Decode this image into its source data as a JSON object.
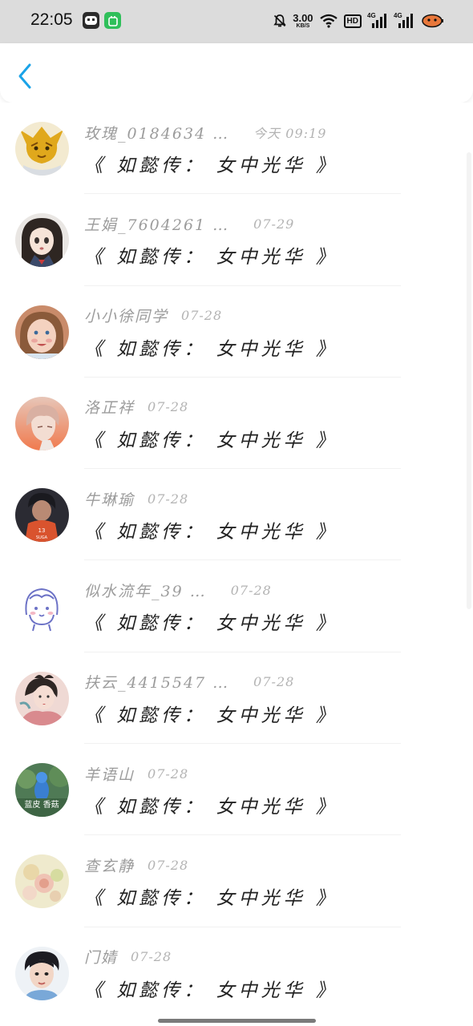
{
  "status_bar": {
    "time": "22:05",
    "apps": [
      "chat-app-icon",
      "green-app-icon"
    ],
    "net_speed": "3.00",
    "net_speed_unit": "KB/S",
    "hd_badge": "HD",
    "signal1_label": "4G",
    "signal2_label": "4G",
    "icons": [
      "bell-muted-icon",
      "wifi-icon",
      "signal-icon",
      "battery-icon"
    ]
  },
  "header": {
    "back_icon": "chevron-left-icon",
    "accent_color": "#1aa3e8"
  },
  "messages": [
    {
      "name": "玫瑰_0184634 …",
      "time": "今天 09:19",
      "text": "《 如懿传： 女中光华 》",
      "avatar": "golden-fox-avatar"
    },
    {
      "name": "王娟_7604261 …",
      "time": "07-29",
      "text": "《 如懿传： 女中光华 》",
      "avatar": "anime-girl-avatar"
    },
    {
      "name": "小小徐同学",
      "time": "07-28",
      "text": "《 如懿传： 女中光华 》",
      "avatar": "child-avatar"
    },
    {
      "name": "洛正祥",
      "time": "07-28",
      "text": "《 如懿传： 女中光华 》",
      "avatar": "anime-boy-sunset-avatar"
    },
    {
      "name": "牛琳瑜",
      "time": "07-28",
      "text": "《 如懿传： 女中光华 》",
      "avatar": "jersey-avatar"
    },
    {
      "name": "似水流年_39 …",
      "time": "07-28",
      "text": "《 如懿传： 女中光华 》",
      "avatar": "doodle-girl-avatar"
    },
    {
      "name": "扶云_4415547 …",
      "time": "07-28",
      "text": "《 如懿传： 女中光华 》",
      "avatar": "painted-lady-avatar"
    },
    {
      "name": "羊语山",
      "time": "07-28",
      "text": "《 如懿传： 女中光华 》",
      "avatar": "blue-figure-avatar"
    },
    {
      "name": "查玄静",
      "time": "07-28",
      "text": "《 如懿传： 女中光华 》",
      "avatar": "flower-avatar"
    },
    {
      "name": "门婧",
      "time": "07-28",
      "text": "《 如懿传： 女中光华 》",
      "avatar": "portrait-avatar"
    }
  ],
  "avatar_text": {
    "blue_figure_caption": "蓝皮 香菇"
  }
}
